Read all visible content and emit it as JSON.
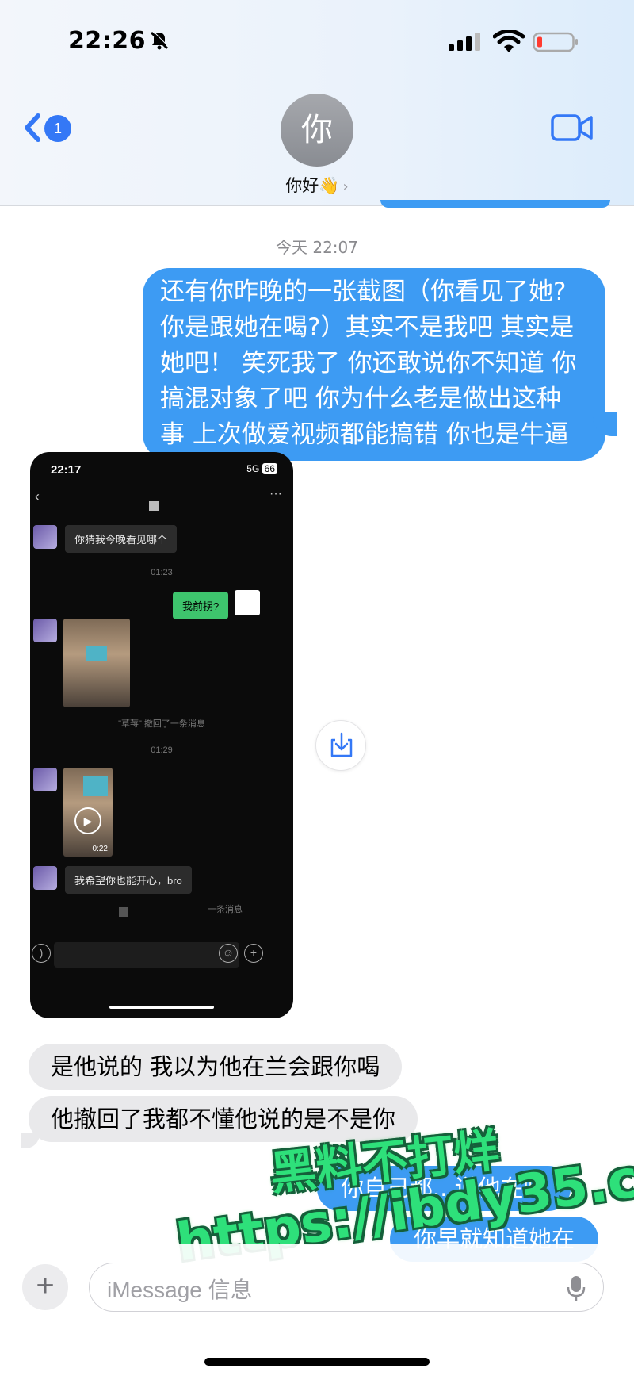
{
  "status_bar": {
    "time": "22:26"
  },
  "header": {
    "back_badge": "1",
    "avatar_text": "你",
    "contact_name": "你好👋",
    "chevron": "›"
  },
  "chat": {
    "timestamp": "今天 22:07",
    "messages_out": {
      "m1_lines": [
        "还有你昨晚的一张截图（你看见了她?",
        "你是跟她在喝?）其实不是我吧 其实是",
        "她吧！ 笑死我了 你还敢说你不知道 你",
        "搞混对象了吧 你为什么老是做出这种",
        "事 上次做爱视频都能搞错 你也是牛逼"
      ],
      "m2": "你自己都...说他在喝",
      "m3": "你早就知道她在"
    },
    "messages_in": {
      "m1": "是他说的 我以为他在兰会跟你喝",
      "m2": "他撤回了我都不懂他说的是不是你"
    }
  },
  "screenshot": {
    "time": "22:17",
    "network": "5G",
    "battery": "66",
    "msg1": "你猜我今晚看见哪个",
    "ts1": "01:23",
    "msg_green": "我前拐?",
    "recall1": "\"草莓\" 撤回了一条消息",
    "ts2": "01:29",
    "video_duration": "0:22",
    "msg2": "我希望你也能开心，bro",
    "recall2": "一条消息"
  },
  "watermark": {
    "line1": "黑料不打烊",
    "line2": "https://ibdy35.com"
  },
  "composer": {
    "placeholder": "iMessage 信息",
    "plus": "+"
  },
  "colors": {
    "accent": "#3478f6",
    "bubble_out": "#3d9bf3",
    "bubble_in": "#e9e9eb"
  }
}
